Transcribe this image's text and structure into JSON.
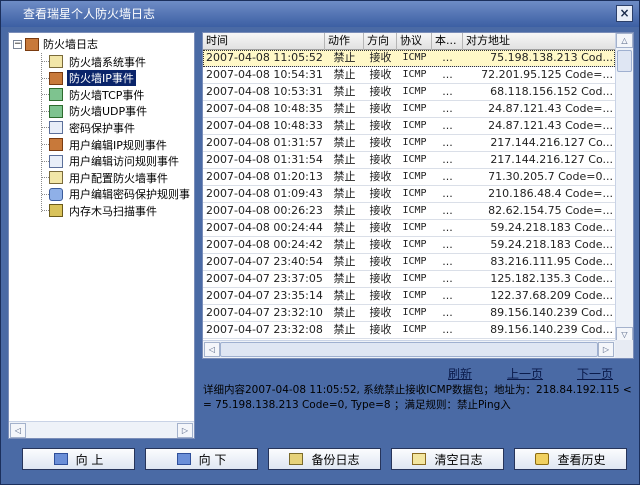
{
  "window": {
    "title": "查看瑞星个人防火墙日志",
    "close_glyph": "×"
  },
  "tree": {
    "root_label": "防火墙日志",
    "items": [
      {
        "label": "防火墙系统事件",
        "icon": "document-icon"
      },
      {
        "label": "防火墙IP事件",
        "icon": "book-icon"
      },
      {
        "label": "防火墙TCP事件",
        "icon": "monitor-icon"
      },
      {
        "label": "防火墙UDP事件",
        "icon": "monitor-icon"
      },
      {
        "label": "密码保护事件",
        "icon": "exe-icon"
      },
      {
        "label": "用户编辑IP规则事件",
        "icon": "book-icon"
      },
      {
        "label": "用户编辑访问规则事件",
        "icon": "exe-icon"
      },
      {
        "label": "用户配置防火墙事件",
        "icon": "document-icon"
      },
      {
        "label": "用户编辑密码保护规则事",
        "icon": "user-icon"
      },
      {
        "label": "内存木马扫描事件",
        "icon": "horse-icon"
      }
    ],
    "selected_index": 1
  },
  "grid": {
    "columns": [
      "时间",
      "动作",
      "方向",
      "协议",
      "本...",
      "对方地址"
    ],
    "rows": [
      {
        "time": "2007-04-08 11:05:52",
        "action": "禁止",
        "dir": "接收",
        "proto": "ICMP",
        "misc": "...",
        "addr": "75.198.138.213 Cod..."
      },
      {
        "time": "2007-04-08 10:54:31",
        "action": "禁止",
        "dir": "接收",
        "proto": "ICMP",
        "misc": "...",
        "addr": "72.201.95.125 Code=..."
      },
      {
        "time": "2007-04-08 10:53:31",
        "action": "禁止",
        "dir": "接收",
        "proto": "ICMP",
        "misc": "...",
        "addr": "68.118.156.152 Cod..."
      },
      {
        "time": "2007-04-08 10:48:35",
        "action": "禁止",
        "dir": "接收",
        "proto": "ICMP",
        "misc": "...",
        "addr": "24.87.121.43 Code=..."
      },
      {
        "time": "2007-04-08 10:48:33",
        "action": "禁止",
        "dir": "接收",
        "proto": "ICMP",
        "misc": "...",
        "addr": "24.87.121.43 Code=..."
      },
      {
        "time": "2007-04-08 01:31:57",
        "action": "禁止",
        "dir": "接收",
        "proto": "ICMP",
        "misc": "...",
        "addr": "217.144.216.127 Co..."
      },
      {
        "time": "2007-04-08 01:31:54",
        "action": "禁止",
        "dir": "接收",
        "proto": "ICMP",
        "misc": "...",
        "addr": "217.144.216.127 Co..."
      },
      {
        "time": "2007-04-08 01:20:13",
        "action": "禁止",
        "dir": "接收",
        "proto": "ICMP",
        "misc": "...",
        "addr": "71.30.205.7 Code=0..."
      },
      {
        "time": "2007-04-08 01:09:43",
        "action": "禁止",
        "dir": "接收",
        "proto": "ICMP",
        "misc": "...",
        "addr": "210.186.48.4 Code=..."
      },
      {
        "time": "2007-04-08 00:26:23",
        "action": "禁止",
        "dir": "接收",
        "proto": "ICMP",
        "misc": "...",
        "addr": "82.62.154.75 Code=..."
      },
      {
        "time": "2007-04-08 00:24:44",
        "action": "禁止",
        "dir": "接收",
        "proto": "ICMP",
        "misc": "...",
        "addr": "59.24.218.183 Code..."
      },
      {
        "time": "2007-04-08 00:24:42",
        "action": "禁止",
        "dir": "接收",
        "proto": "ICMP",
        "misc": "...",
        "addr": "59.24.218.183 Code..."
      },
      {
        "time": "2007-04-07 23:40:54",
        "action": "禁止",
        "dir": "接收",
        "proto": "ICMP",
        "misc": "...",
        "addr": "83.216.111.95 Code..."
      },
      {
        "time": "2007-04-07 23:37:05",
        "action": "禁止",
        "dir": "接收",
        "proto": "ICMP",
        "misc": "...",
        "addr": "125.182.135.3 Code..."
      },
      {
        "time": "2007-04-07 23:35:14",
        "action": "禁止",
        "dir": "接收",
        "proto": "ICMP",
        "misc": "...",
        "addr": "122.37.68.209 Code..."
      },
      {
        "time": "2007-04-07 23:32:10",
        "action": "禁止",
        "dir": "接收",
        "proto": "ICMP",
        "misc": "...",
        "addr": "89.156.140.239 Cod..."
      },
      {
        "time": "2007-04-07 23:32:08",
        "action": "禁止",
        "dir": "接收",
        "proto": "ICMP",
        "misc": "...",
        "addr": "89.156.140.239 Cod..."
      }
    ],
    "selected_index": 0
  },
  "pager": {
    "refresh": "刷新",
    "prev": "上一页",
    "next": "下一页"
  },
  "detail": {
    "text": "详细内容2007-04-08 11:05:52, 系统禁止接收ICMP数据包；地址为：218.84.192.115 <= 75.198.138.213 Code=0, Type=8 ；满足规则：禁止Ping入"
  },
  "buttons": {
    "up": "向 上",
    "down": "向 下",
    "backup": "备份日志",
    "clear": "清空日志",
    "history": "查看历史"
  },
  "colors": {
    "window_bg": "#4a6aa5",
    "selection": "#0a246a",
    "selected_row": "#fff8c8"
  }
}
